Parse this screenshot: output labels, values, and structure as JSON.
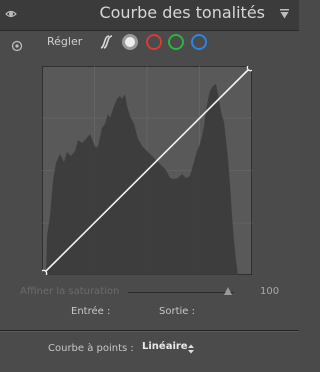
{
  "header": {
    "title": "Courbe des tonalités"
  },
  "toolbar": {
    "adjust_label": "Régler",
    "channels": [
      "parametric",
      "rgb",
      "red",
      "green",
      "blue"
    ]
  },
  "colors": {
    "red": "#d63a3a",
    "green": "#2bb43e",
    "blue": "#2f84e0",
    "panel": "#4b4b4b"
  },
  "saturation": {
    "label": "Affiner la saturation",
    "value": "100",
    "level_fraction": 1.0
  },
  "io": {
    "input_label": "Entrée :",
    "output_label": "Sortie :"
  },
  "points": {
    "label": "Courbe à points :",
    "selected": "Linéaire"
  }
}
